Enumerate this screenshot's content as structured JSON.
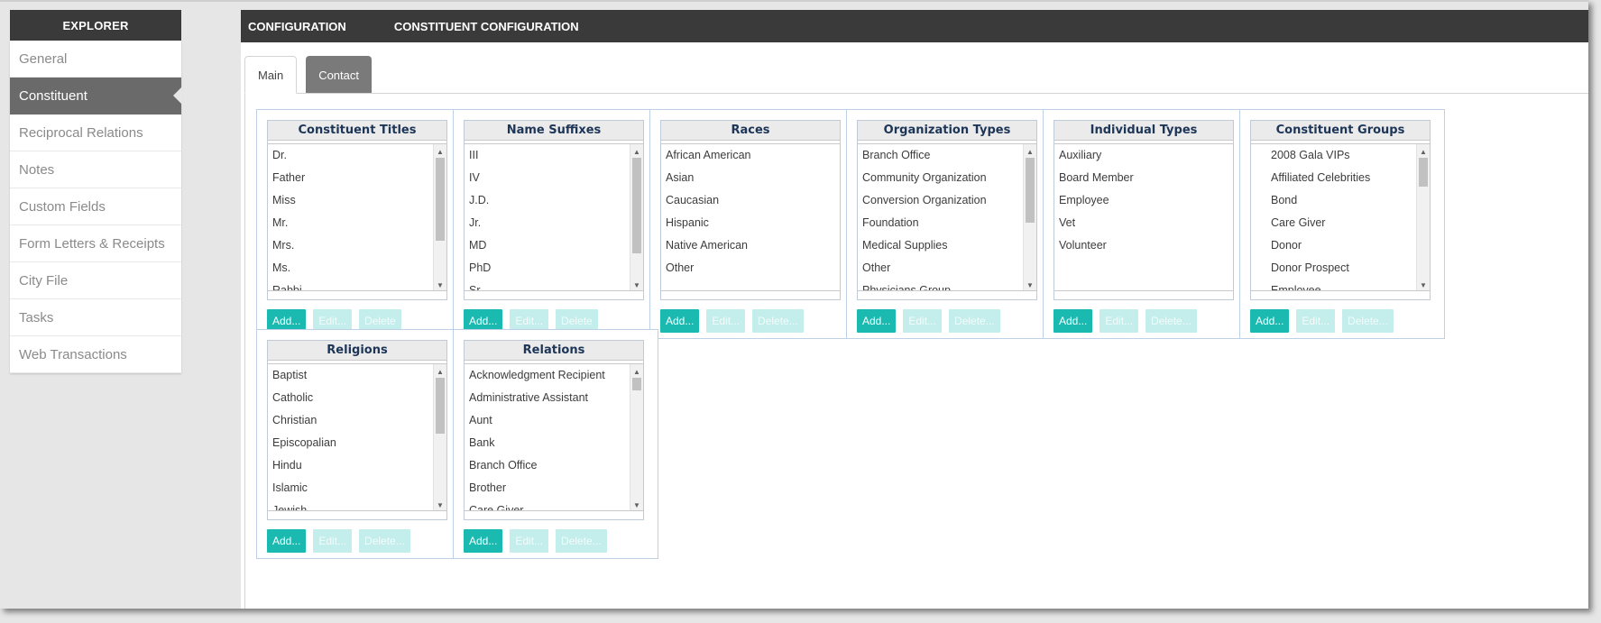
{
  "sidebar": {
    "header": "EXPLORER",
    "items": [
      {
        "label": "General"
      },
      {
        "label": "Constituent"
      },
      {
        "label": "Reciprocal Relations"
      },
      {
        "label": "Notes"
      },
      {
        "label": "Custom Fields"
      },
      {
        "label": "Form Letters & Receipts"
      },
      {
        "label": "City File"
      },
      {
        "label": "Tasks"
      },
      {
        "label": "Web Transactions"
      }
    ],
    "active_index": 1
  },
  "header": {
    "breadcrumb": [
      "CONFIGURATION",
      "CONSTITUENT CONFIGURATION"
    ]
  },
  "tabs": [
    {
      "label": "Main",
      "active": true
    },
    {
      "label": "Contact",
      "active": false
    }
  ],
  "colors": {
    "accent": "#1bbab0",
    "accent_disabled": "#c4eeeb",
    "header_bg": "#3a3a3a",
    "title_text": "#1d3557"
  },
  "cards": [
    {
      "title": "Constituent Titles",
      "items": [
        "Dr.",
        "Father",
        "Miss",
        "Mr.",
        "Mrs.",
        "Ms.",
        "Rabbi"
      ],
      "buttons": [
        "Add...",
        "Edit...",
        "Delete"
      ],
      "scrollbar": true,
      "indent": false
    },
    {
      "title": "Name Suffixes",
      "items": [
        "III",
        "IV",
        "J.D.",
        "Jr.",
        "MD",
        "PhD",
        "Sr."
      ],
      "buttons": [
        "Add...",
        "Edit...",
        "Delete"
      ],
      "scrollbar": true,
      "indent": false
    },
    {
      "title": "Races",
      "items": [
        "African American",
        "Asian",
        "Caucasian",
        "Hispanic",
        "Native American",
        "Other"
      ],
      "buttons": [
        "Add...",
        "Edit...",
        "Delete..."
      ],
      "scrollbar": false,
      "indent": false
    },
    {
      "title": "Organization Types",
      "items": [
        "Branch Office",
        "Community Organization",
        "Conversion Organization",
        "Foundation",
        "Medical Supplies",
        "Other",
        "Physicians Group"
      ],
      "buttons": [
        "Add...",
        "Edit...",
        "Delete..."
      ],
      "scrollbar": true,
      "indent": false
    },
    {
      "title": "Individual Types",
      "items": [
        "Auxiliary",
        "Board Member",
        "Employee",
        "Vet",
        "Volunteer"
      ],
      "buttons": [
        "Add...",
        "Edit...",
        "Delete..."
      ],
      "scrollbar": false,
      "indent": false
    },
    {
      "title": "Constituent Groups",
      "items": [
        "2008 Gala VIPs",
        "Affiliated Celebrities",
        "Bond",
        "Care Giver",
        "Donor",
        "Donor Prospect",
        "Employee"
      ],
      "buttons": [
        "Add...",
        "Edit...",
        "Delete..."
      ],
      "scrollbar": true,
      "indent": true
    },
    {
      "title": "Religions",
      "items": [
        "Baptist",
        "Catholic",
        "Christian",
        "Episcopalian",
        "Hindu",
        "Islamic",
        "Jewish"
      ],
      "buttons": [
        "Add...",
        "Edit...",
        "Delete..."
      ],
      "scrollbar": true,
      "indent": false
    },
    {
      "title": "Relations",
      "items": [
        "Acknowledgment Recipient",
        "Administrative Assistant",
        "Aunt",
        "Bank",
        "Branch Office",
        "Brother",
        "Care Giver"
      ],
      "buttons": [
        "Add...",
        "Edit...",
        "Delete..."
      ],
      "scrollbar": true,
      "indent": false
    }
  ]
}
